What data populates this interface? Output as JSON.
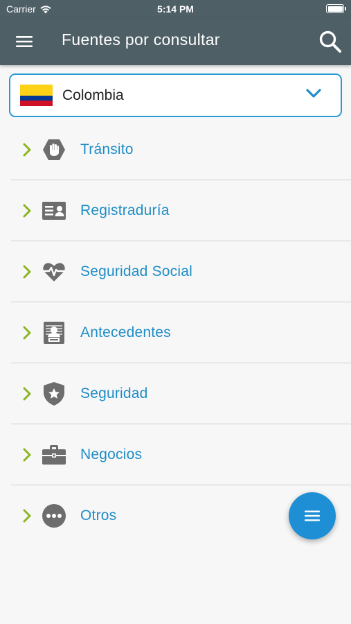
{
  "status_bar": {
    "carrier": "Carrier",
    "time": "5:14 PM"
  },
  "app_bar": {
    "title": "Fuentes por consultar"
  },
  "country_select": {
    "selected": "Colombia"
  },
  "categories": [
    {
      "label": "Tránsito",
      "icon": "hand-stop-icon"
    },
    {
      "label": "Registraduría",
      "icon": "id-card-icon"
    },
    {
      "label": "Seguridad Social",
      "icon": "heartbeat-icon"
    },
    {
      "label": "Antecedentes",
      "icon": "criminal-record-icon"
    },
    {
      "label": "Seguridad",
      "icon": "shield-star-icon"
    },
    {
      "label": "Negocios",
      "icon": "briefcase-icon"
    },
    {
      "label": "Otros",
      "icon": "more-dots-icon"
    }
  ],
  "colors": {
    "app_bar": "#4f5f66",
    "accent": "#1f8dc6",
    "chevron": "#8ab520",
    "icon_gray": "#6d6d6d",
    "fab": "#1e8fd4"
  }
}
